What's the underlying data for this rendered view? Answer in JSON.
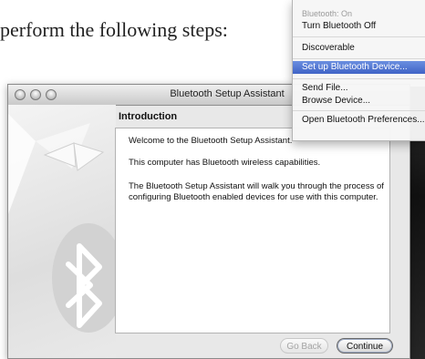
{
  "document": {
    "text": "perform the following steps:"
  },
  "window": {
    "title": "Bluetooth Setup Assistant",
    "section_heading": "Introduction",
    "paragraphs": [
      "Welcome to the Bluetooth Setup Assistant.",
      "This computer has Bluetooth wireless capabilities.",
      "The Bluetooth Setup Assistant will walk you through the process of configuring Bluetooth enabled devices for use with this computer."
    ],
    "buttons": {
      "back": "Go Back",
      "continue": "Continue"
    }
  },
  "menu": {
    "status": "Bluetooth: On",
    "turn_off": "Turn Bluetooth Off",
    "discoverable": "Discoverable",
    "setup_device": "Set up Bluetooth Device...",
    "send_file": "Send File...",
    "browse_device": "Browse Device...",
    "open_prefs": "Open Bluetooth Preferences..."
  },
  "colors": {
    "menu_highlight": "#3f63c6"
  }
}
